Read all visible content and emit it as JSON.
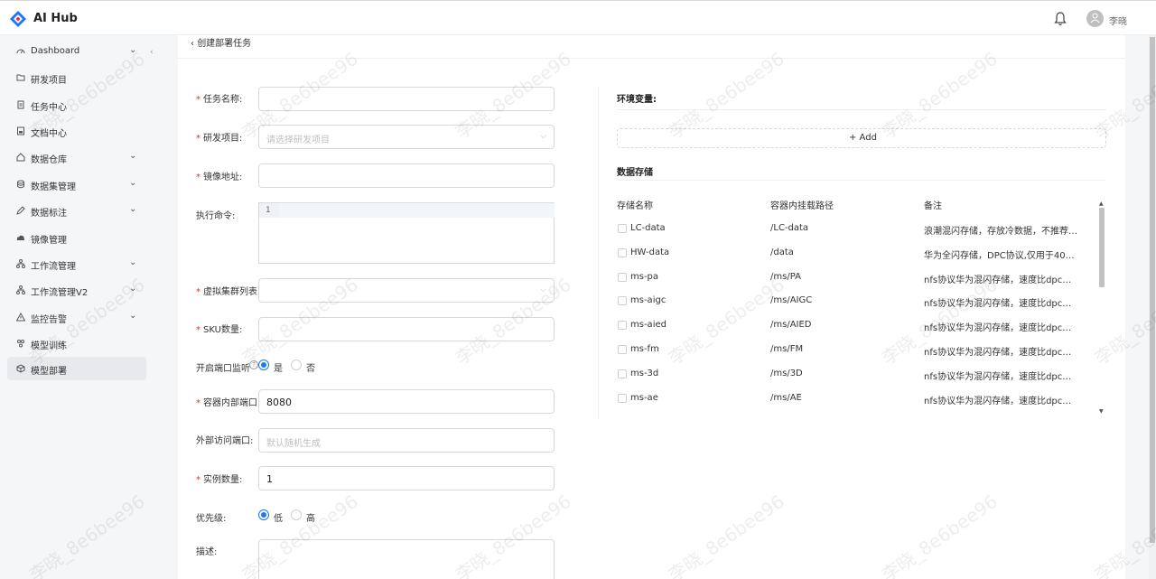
{
  "app": {
    "name": "AI Hub",
    "user": "李晓"
  },
  "sidebar": {
    "items": [
      {
        "label": "Dashboard",
        "icon": "dashboard-icon",
        "expandable": true
      },
      {
        "label": "研发项目",
        "icon": "folder-icon",
        "expandable": false
      },
      {
        "label": "任务中心",
        "icon": "task-icon",
        "expandable": false
      },
      {
        "label": "文档中心",
        "icon": "document-icon",
        "expandable": false
      },
      {
        "label": "数据仓库",
        "icon": "home-icon",
        "expandable": true
      },
      {
        "label": "数据集管理",
        "icon": "database-icon",
        "expandable": true
      },
      {
        "label": "数据标注",
        "icon": "tag-icon",
        "expandable": true
      },
      {
        "label": "镜像管理",
        "icon": "cloud-icon",
        "expandable": false
      },
      {
        "label": "工作流管理",
        "icon": "workflow-icon",
        "expandable": true
      },
      {
        "label": "工作流管理V2",
        "icon": "workflow-icon",
        "expandable": true
      },
      {
        "label": "监控告警",
        "icon": "alert-icon",
        "expandable": true
      },
      {
        "label": "模型训练",
        "icon": "training-icon",
        "expandable": false
      },
      {
        "label": "模型部署",
        "icon": "deploy-icon",
        "expandable": false,
        "active": true
      }
    ]
  },
  "page": {
    "back_label": "创建部署任务"
  },
  "form": {
    "task_name": {
      "label": "任务名称:",
      "value": ""
    },
    "project": {
      "label": "研发项目:",
      "placeholder": "请选择研发项目"
    },
    "image": {
      "label": "镜像地址:",
      "value": ""
    },
    "command": {
      "label": "执行命令:",
      "line_number": "1"
    },
    "cluster": {
      "label": "虚拟集群列表:"
    },
    "sku": {
      "label": "SKU数量:",
      "value": ""
    },
    "port_monitor": {
      "label": "开启端口监听",
      "help": "?",
      "yes": "是",
      "no": "否",
      "selected": "是"
    },
    "container_port": {
      "label": "容器内部端口:",
      "value": "8080"
    },
    "external_port": {
      "label": "外部访问端口:",
      "placeholder": "默认随机生成"
    },
    "instances": {
      "label": "实例数量:",
      "value": "1"
    },
    "priority": {
      "label": "优先级:",
      "low": "低",
      "high": "高",
      "selected": "低"
    },
    "description": {
      "label": "描述:"
    }
  },
  "env": {
    "title": "环境变量:",
    "add_label": "+ Add"
  },
  "storage": {
    "title": "数据存储",
    "columns": [
      "存储名称",
      "容器内挂载路径",
      "备注"
    ],
    "rows": [
      {
        "name": "LC-data",
        "path": "/LC-data",
        "note": "浪潮混闪存储，存放冷数据，不推荐用..."
      },
      {
        "name": "HW-data",
        "path": "/data",
        "note": "华为全闪存储，DPC协议,仅用于4090..."
      },
      {
        "name": "ms-pa",
        "path": "/ms/PA",
        "note": "nfs协议华为混闪存储，速度比dpc协议..."
      },
      {
        "name": "ms-aigc",
        "path": "/ms/AIGC",
        "note": "nfs协议华为混闪存储，速度比dpc协议..."
      },
      {
        "name": "ms-aied",
        "path": "/ms/AIED",
        "note": "nfs协议华为混闪存储，速度比dpc协议..."
      },
      {
        "name": "ms-fm",
        "path": "/ms/FM",
        "note": "nfs协议华为混闪存储，速度比dpc协议..."
      },
      {
        "name": "ms-3d",
        "path": "/ms/3D",
        "note": "nfs协议华为混闪存储，速度比dpc协议..."
      },
      {
        "name": "ms-ae",
        "path": "/ms/AE",
        "note": "nfs协议华为混闪存储，速度比dpc协议..."
      }
    ]
  },
  "watermark": "李晓_8e6bee96"
}
